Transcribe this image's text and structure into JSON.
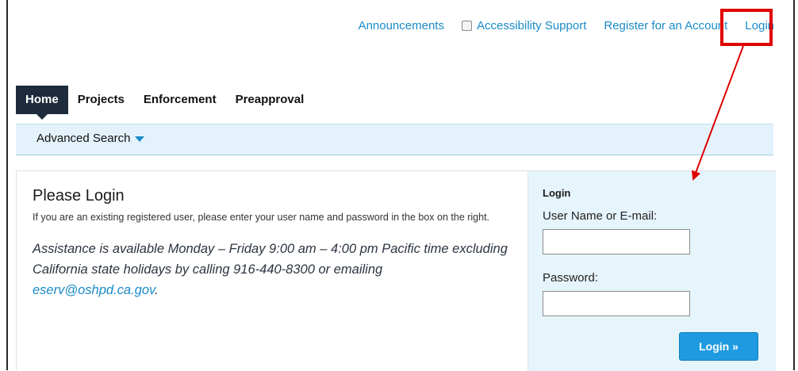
{
  "top_links": {
    "announcements": "Announcements",
    "accessibility": "Accessibility Support",
    "register": "Register for an Account",
    "login": "Login"
  },
  "nav": {
    "tabs": [
      "Home",
      "Projects",
      "Enforcement",
      "Preapproval"
    ],
    "active": "Home"
  },
  "subnav": {
    "advanced_search": "Advanced Search"
  },
  "main": {
    "title": "Please Login",
    "description": "If you are an existing registered user, please enter your user name and password in the box on the right.",
    "assist_text": "Assistance is available Monday – Friday 9:00 am – 4:00 pm Pacific time excluding California state holidays by calling 916-440-8300 or emailing",
    "assist_email": "eserv@oshpd.ca.gov",
    "assist_period": "."
  },
  "login_panel": {
    "title": "Login",
    "username_label": "User Name or E-mail:",
    "username_value": "",
    "password_label": "Password:",
    "password_value": "",
    "button_label": "Login »"
  },
  "colors": {
    "link": "#1a8bc7",
    "nav_active": "#1e2b3c",
    "highlight_annotation": "#e00000",
    "button": "#1e9be0",
    "panel_bg": "#e6f4fb"
  },
  "icons": [
    "checkbox-icon",
    "chevron-down-icon"
  ]
}
